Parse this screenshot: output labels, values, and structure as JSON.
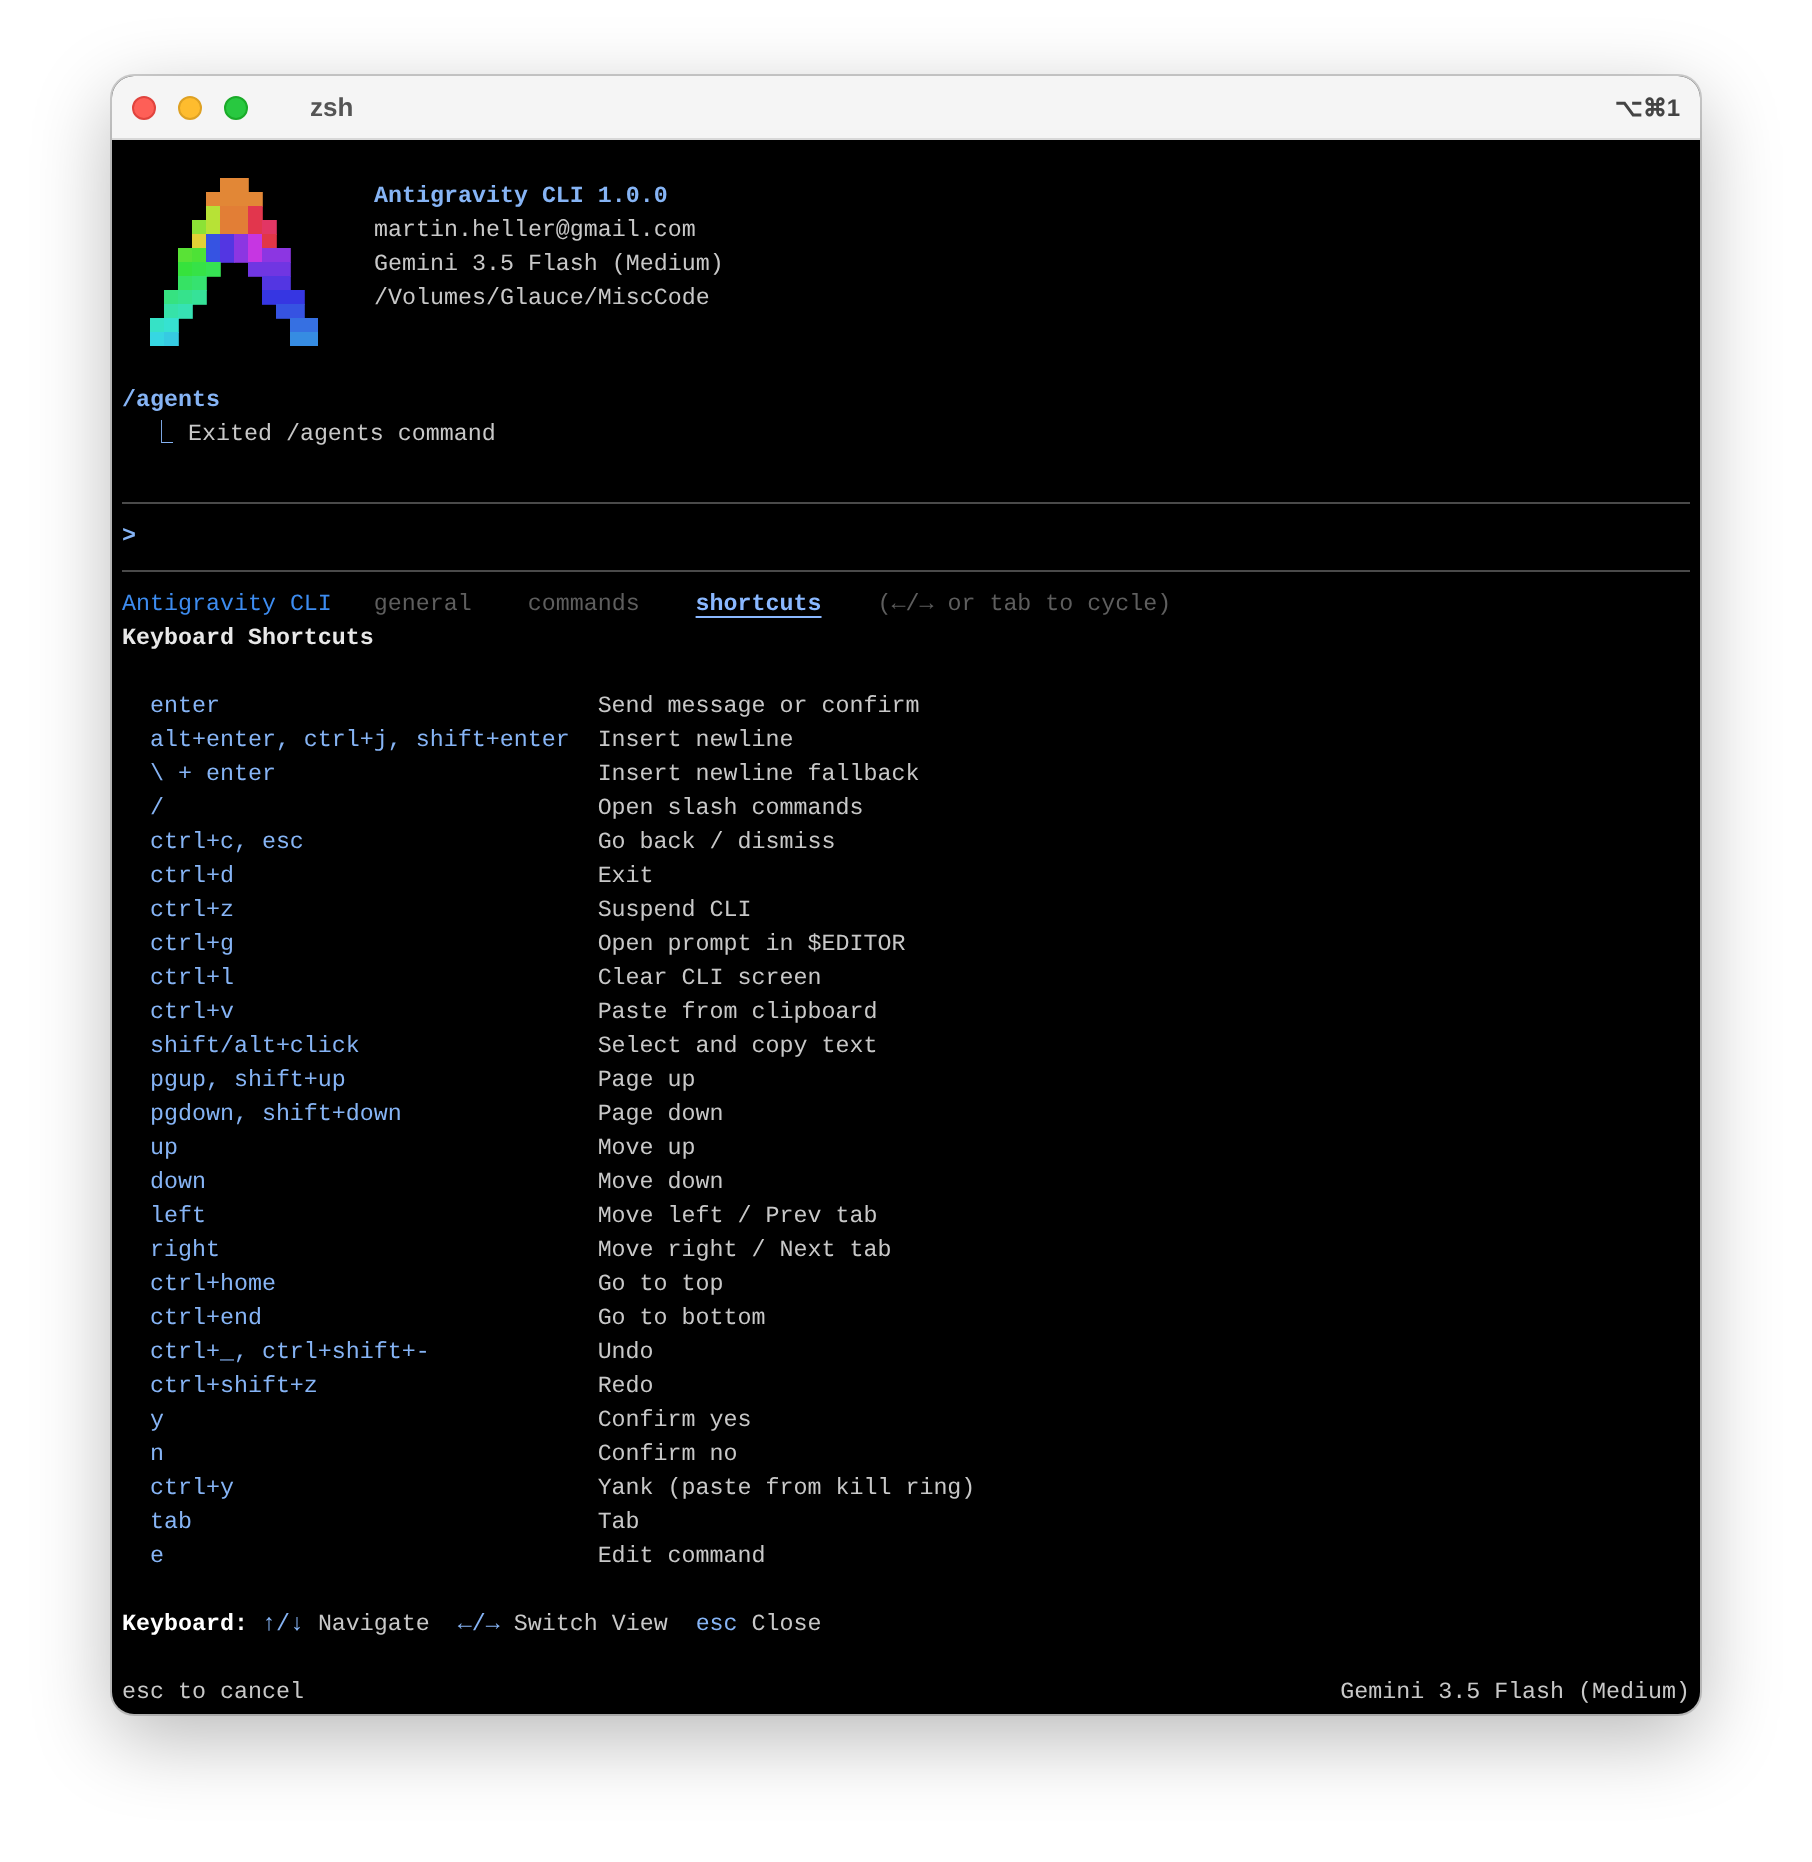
{
  "window": {
    "title": "zsh",
    "shortcut": "⌥⌘1"
  },
  "header": {
    "app": "Antigravity CLI 1.0.0",
    "account": "martin.heller@gmail.com",
    "model": "Gemini 3.5 Flash (Medium)",
    "path": "/Volumes/Glauce/MiscCode"
  },
  "history": [
    {
      "command": "/agents",
      "branch": "⎿",
      "result": "Exited /agents command"
    }
  ],
  "prompt": {
    "symbol": ">"
  },
  "help": {
    "title": "Antigravity CLI",
    "tabs": [
      {
        "label": "general",
        "selected": false
      },
      {
        "label": "commands",
        "selected": false
      },
      {
        "label": "shortcuts",
        "selected": true
      }
    ],
    "hint": "(←/→ or tab to cycle)",
    "heading": "Keyboard Shortcuts",
    "shortcuts": [
      {
        "keys": "enter",
        "action": "Send message or confirm"
      },
      {
        "keys": "alt+enter, ctrl+j, shift+enter",
        "action": "Insert newline"
      },
      {
        "keys": "\\ + enter",
        "action": "Insert newline fallback"
      },
      {
        "keys": "/",
        "action": "Open slash commands"
      },
      {
        "keys": "ctrl+c, esc",
        "action": "Go back / dismiss"
      },
      {
        "keys": "ctrl+d",
        "action": "Exit"
      },
      {
        "keys": "ctrl+z",
        "action": "Suspend CLI"
      },
      {
        "keys": "ctrl+g",
        "action": "Open prompt in $EDITOR"
      },
      {
        "keys": "ctrl+l",
        "action": "Clear CLI screen"
      },
      {
        "keys": "ctrl+v",
        "action": "Paste from clipboard"
      },
      {
        "keys": "shift/alt+click",
        "action": "Select and copy text"
      },
      {
        "keys": "pgup, shift+up",
        "action": "Page up"
      },
      {
        "keys": "pgdown, shift+down",
        "action": "Page down"
      },
      {
        "keys": "up",
        "action": "Move up"
      },
      {
        "keys": "down",
        "action": "Move down"
      },
      {
        "keys": "left",
        "action": "Move left / Prev tab"
      },
      {
        "keys": "right",
        "action": "Move right / Next tab"
      },
      {
        "keys": "ctrl+home",
        "action": "Go to top"
      },
      {
        "keys": "ctrl+end",
        "action": "Go to bottom"
      },
      {
        "keys": "ctrl+_, ctrl+shift+-",
        "action": "Undo"
      },
      {
        "keys": "ctrl+shift+z",
        "action": "Redo"
      },
      {
        "keys": "y",
        "action": "Confirm yes"
      },
      {
        "keys": "n",
        "action": "Confirm no"
      },
      {
        "keys": "ctrl+y",
        "action": "Yank (paste from kill ring)"
      },
      {
        "keys": "tab",
        "action": "Tab"
      },
      {
        "keys": "e",
        "action": "Edit command"
      }
    ],
    "footer": {
      "label": "Keyboard:",
      "items": [
        {
          "key": "↑/↓",
          "action": "Navigate"
        },
        {
          "key": "←/→",
          "action": "Switch View"
        },
        {
          "key": "esc",
          "action": "Close"
        }
      ]
    }
  },
  "status_bar": {
    "left": "esc to cancel",
    "right": "Gemini 3.5 Flash (Medium)"
  }
}
